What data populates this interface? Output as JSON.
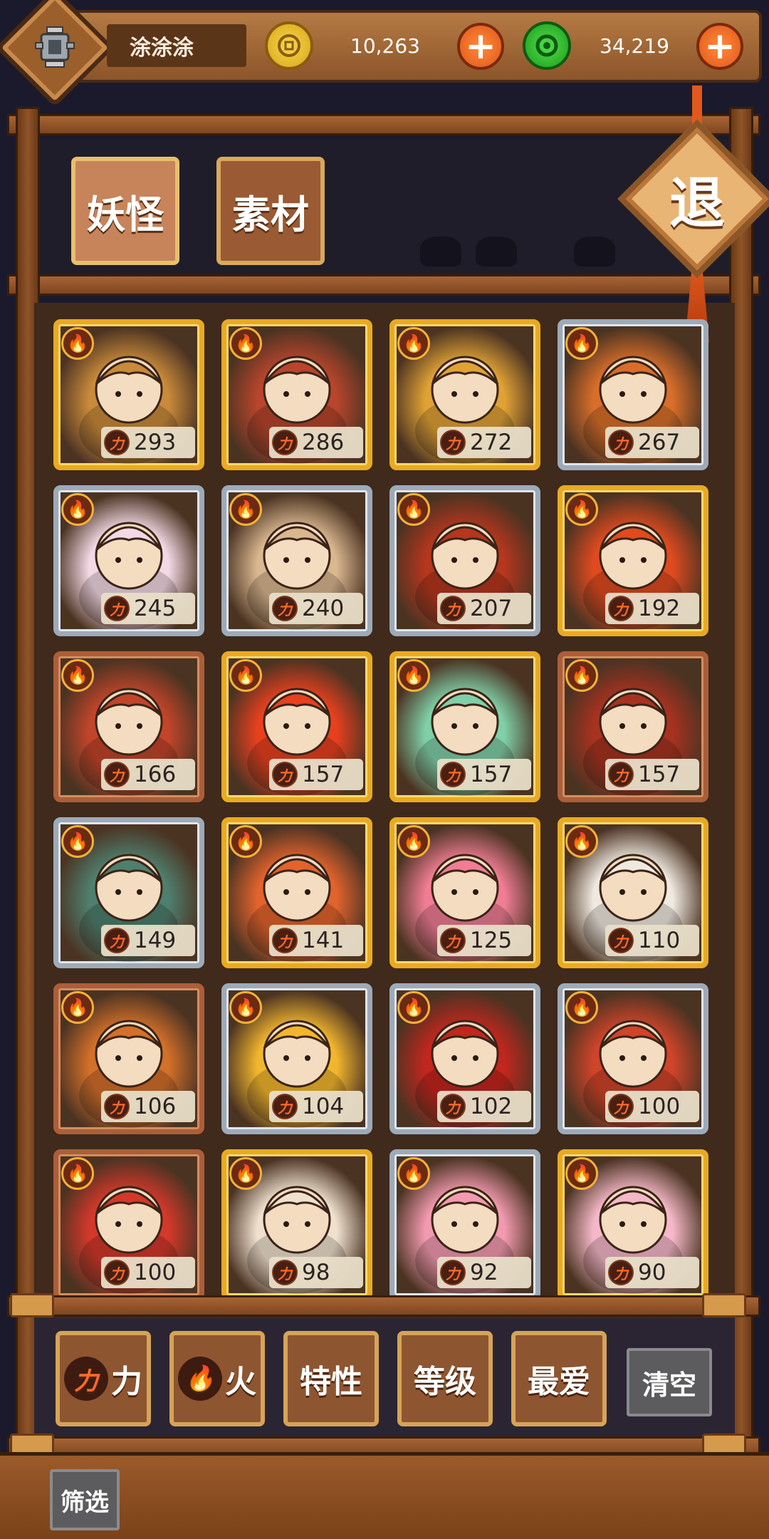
{
  "header": {
    "player_name": "涂涂涂",
    "coins": "10,263",
    "jade": "34,219",
    "plus_label": "+"
  },
  "tabs": [
    {
      "label": "妖怪",
      "active": true
    },
    {
      "label": "素材",
      "active": false
    }
  ],
  "exit_label": "退",
  "cards": [
    {
      "power": "293",
      "frame": "gold",
      "color": "#c98a3a"
    },
    {
      "power": "286",
      "frame": "gold",
      "color": "#b8452c"
    },
    {
      "power": "272",
      "frame": "gold",
      "color": "#e0a235"
    },
    {
      "power": "267",
      "frame": "silver",
      "color": "#d86e2a"
    },
    {
      "power": "245",
      "frame": "silver",
      "color": "#f3d9e5"
    },
    {
      "power": "240",
      "frame": "silver",
      "color": "#d9b78f"
    },
    {
      "power": "207",
      "frame": "silver",
      "color": "#b6361e"
    },
    {
      "power": "192",
      "frame": "gold",
      "color": "#e04a1f"
    },
    {
      "power": "166",
      "frame": "bronze",
      "color": "#c2452a"
    },
    {
      "power": "157",
      "frame": "gold",
      "color": "#e8401e"
    },
    {
      "power": "157",
      "frame": "gold",
      "color": "#7fcfa8"
    },
    {
      "power": "157",
      "frame": "bronze",
      "color": "#a83220"
    },
    {
      "power": "149",
      "frame": "silver",
      "color": "#4f7f6e"
    },
    {
      "power": "141",
      "frame": "gold",
      "color": "#e2632d"
    },
    {
      "power": "125",
      "frame": "gold",
      "color": "#f07d94"
    },
    {
      "power": "110",
      "frame": "gold",
      "color": "#efe9e0"
    },
    {
      "power": "106",
      "frame": "bronze",
      "color": "#d3702a"
    },
    {
      "power": "104",
      "frame": "silver",
      "color": "#f2b62e"
    },
    {
      "power": "102",
      "frame": "silver",
      "color": "#c2261e"
    },
    {
      "power": "100",
      "frame": "silver",
      "color": "#d0442a"
    },
    {
      "power": "100",
      "frame": "bronze",
      "color": "#d4382a"
    },
    {
      "power": "98",
      "frame": "gold",
      "color": "#f0e1cf"
    },
    {
      "power": "92",
      "frame": "silver",
      "color": "#f29ab0"
    },
    {
      "power": "90",
      "frame": "gold",
      "color": "#f5b8c8"
    }
  ],
  "filters": {
    "power": "力",
    "fire": "火",
    "trait": "特性",
    "level": "等级",
    "favorite": "最爱",
    "clear": "清空",
    "screen": "筛选"
  },
  "icons": {
    "power_icon_glyph": "力",
    "fire_glyph": "🔥"
  }
}
